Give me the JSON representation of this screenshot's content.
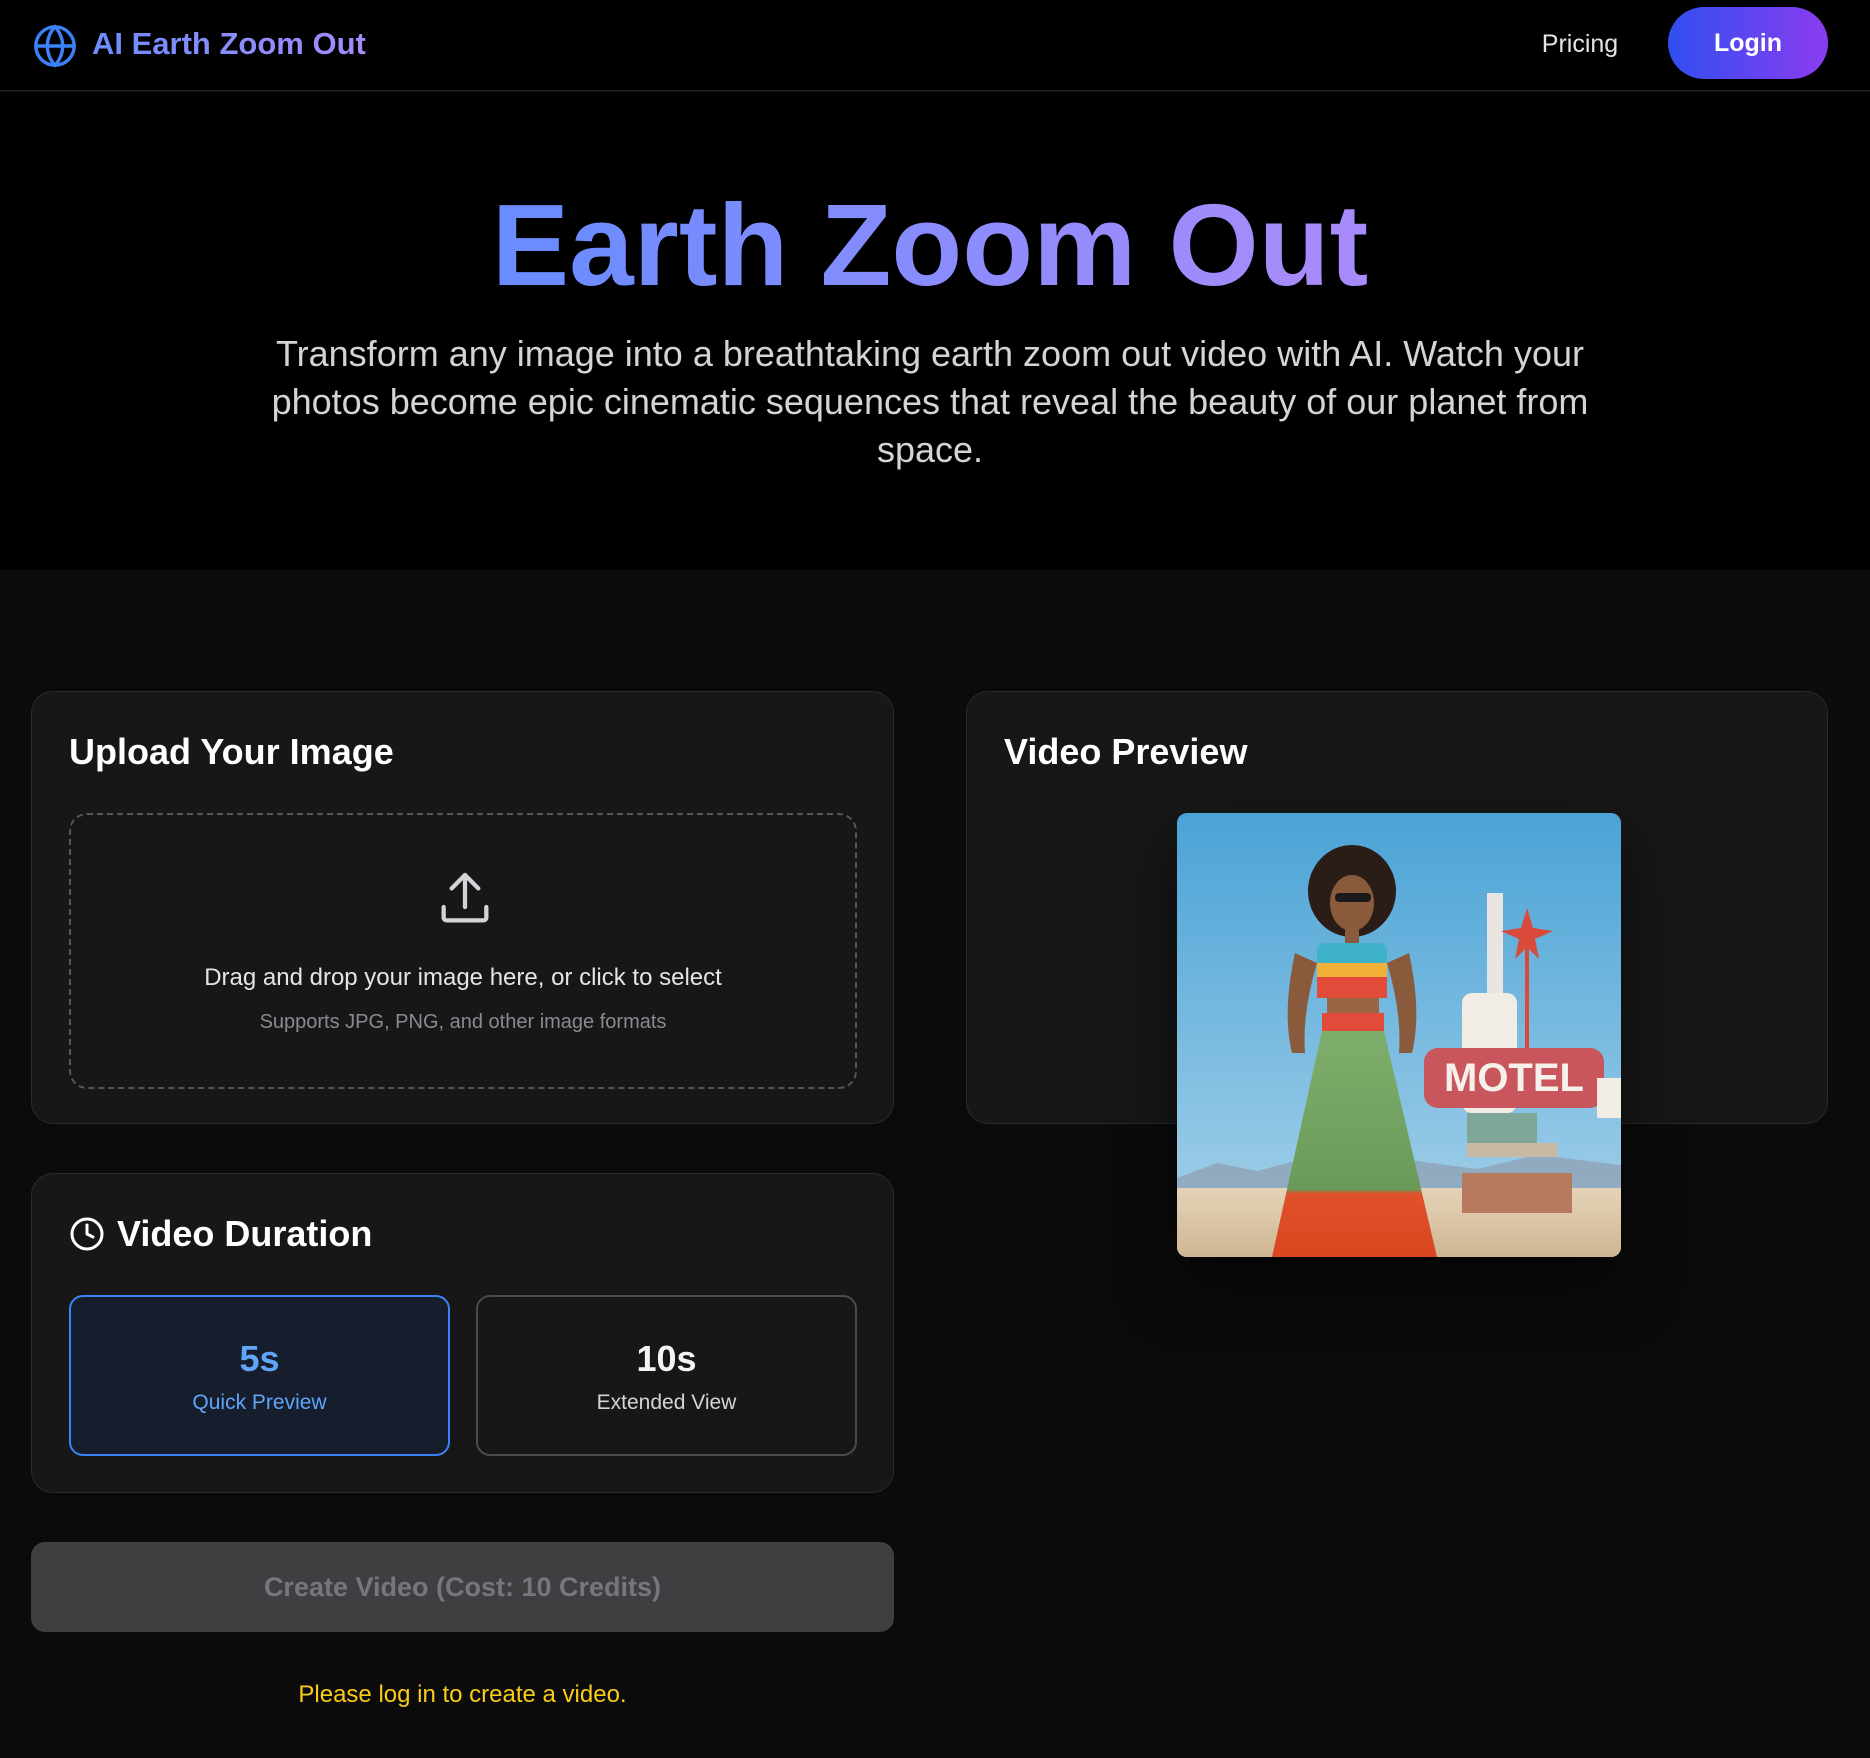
{
  "header": {
    "logo_icon": "globe-icon",
    "logo_text": "AI Earth Zoom Out",
    "nav_pricing": "Pricing",
    "login_label": "Login"
  },
  "hero": {
    "title": "Earth Zoom Out",
    "subtitle": "Transform any image into a breathtaking earth zoom out video with AI. Watch your photos become epic cinematic sequences that reveal the beauty of our planet from space."
  },
  "upload": {
    "title": "Upload Your Image",
    "icon": "upload-icon",
    "drop_text": "Drag and drop your image here, or click to select",
    "hint": "Supports JPG, PNG, and other image formats"
  },
  "duration": {
    "title": "Video Duration",
    "icon": "clock-icon",
    "options": [
      {
        "value": "5s",
        "label": "Quick Preview",
        "selected": true
      },
      {
        "value": "10s",
        "label": "Extended View",
        "selected": false
      }
    ]
  },
  "actions": {
    "create_label": "Create Video (Cost: 10 Credits)",
    "login_note": "Please log in to create a video."
  },
  "preview": {
    "title": "Video Preview",
    "motel_sign": "MOTEL"
  },
  "colors": {
    "accent_blue": "#3b82f6",
    "gradient_start": "#6b8cff",
    "gradient_end": "#a78bfa",
    "warning": "#facc15"
  }
}
